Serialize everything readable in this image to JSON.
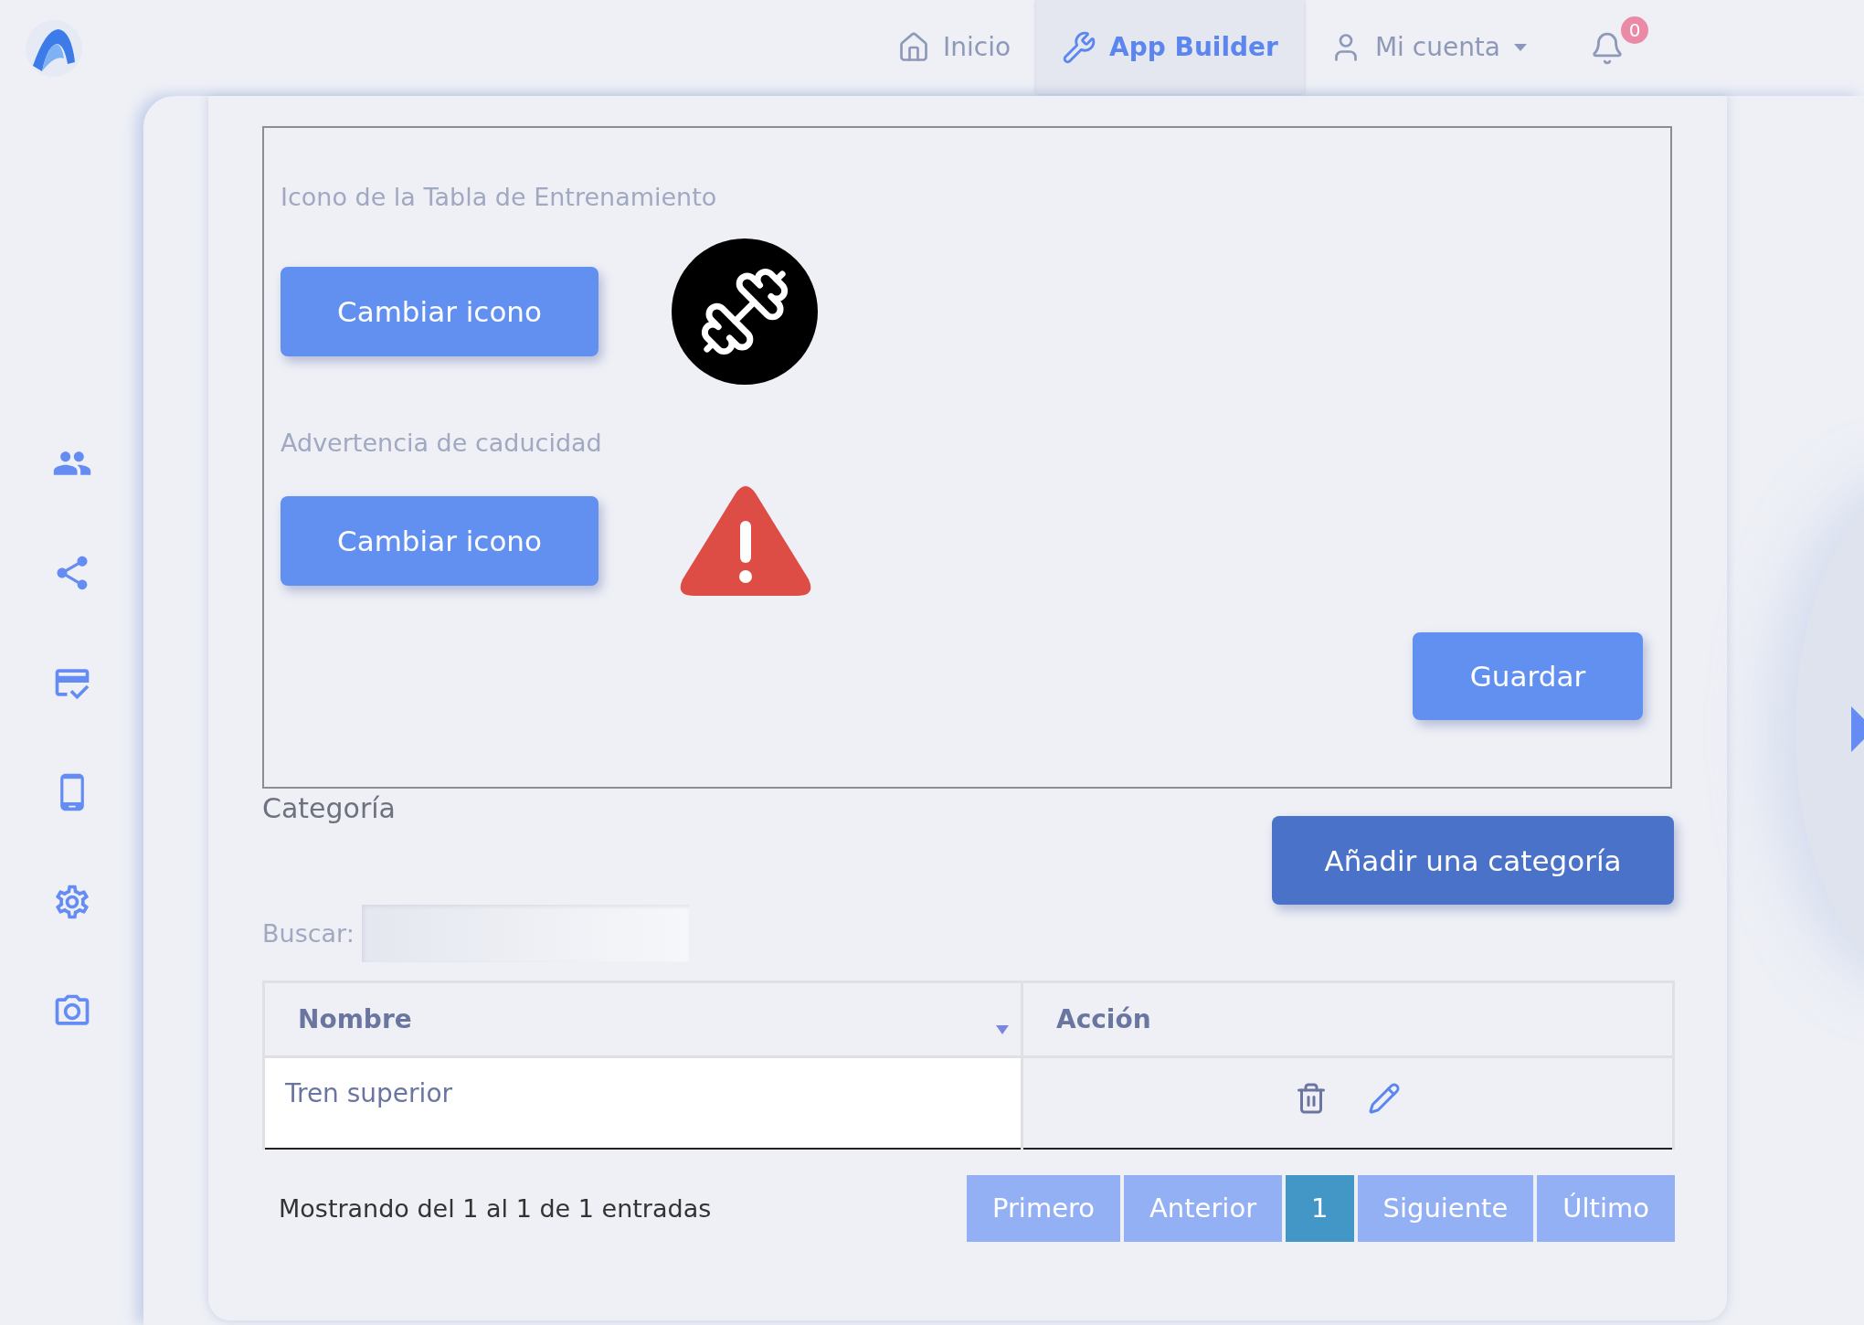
{
  "nav": {
    "items": [
      {
        "label": "Inicio",
        "selected": false,
        "dropdown": false
      },
      {
        "label": "App Builder",
        "selected": true,
        "dropdown": false
      },
      {
        "label": "Mi cuenta",
        "selected": false,
        "dropdown": true
      }
    ],
    "notifications": {
      "count": "0"
    }
  },
  "icon_settings": {
    "sections": [
      {
        "label": "Icono de la Tabla de Entrenamiento",
        "button": "Cambiar icono"
      },
      {
        "label": "Advertencia de caducidad",
        "button": "Cambiar icono"
      }
    ],
    "save_button": "Guardar"
  },
  "category": {
    "title": "Categoría",
    "add_button": "Añadir una categoría",
    "search_label": "Buscar:"
  },
  "table": {
    "columns": [
      {
        "label": "Nombre",
        "sorted": true
      },
      {
        "label": "Acción",
        "sorted": false
      }
    ],
    "rows": [
      {
        "name": "Tren superior"
      }
    ]
  },
  "footer": {
    "info": "Mostrando del 1 al 1 de 1 entradas",
    "pages": [
      {
        "label": "Primero",
        "selected": false
      },
      {
        "label": "Anterior",
        "selected": false
      },
      {
        "label": "1",
        "selected": true
      },
      {
        "label": "Siguiente",
        "selected": false
      },
      {
        "label": "Último",
        "selected": false
      }
    ]
  }
}
